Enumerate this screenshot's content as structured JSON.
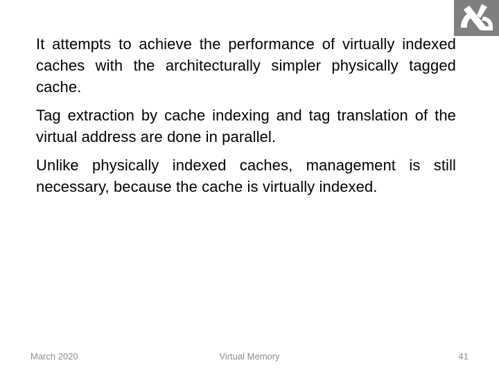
{
  "slide": {
    "paragraphs": [
      "It attempts to achieve the performance of virtually indexed caches with the architecturally simpler physically tagged cache.",
      "Tag extraction by cache indexing and tag translation of the virtual address are done in parallel.",
      "Unlike physically indexed caches, management is still necessary, because the cache is virtually indexed."
    ],
    "logo_icon": "institution-logo-icon",
    "colors": {
      "logo_background": "#7f7f7f",
      "text": "#000000",
      "footer_text": "#8c8c8c"
    }
  },
  "footer": {
    "date": "March 2020",
    "title": "Virtual Memory",
    "page_number": "41"
  }
}
